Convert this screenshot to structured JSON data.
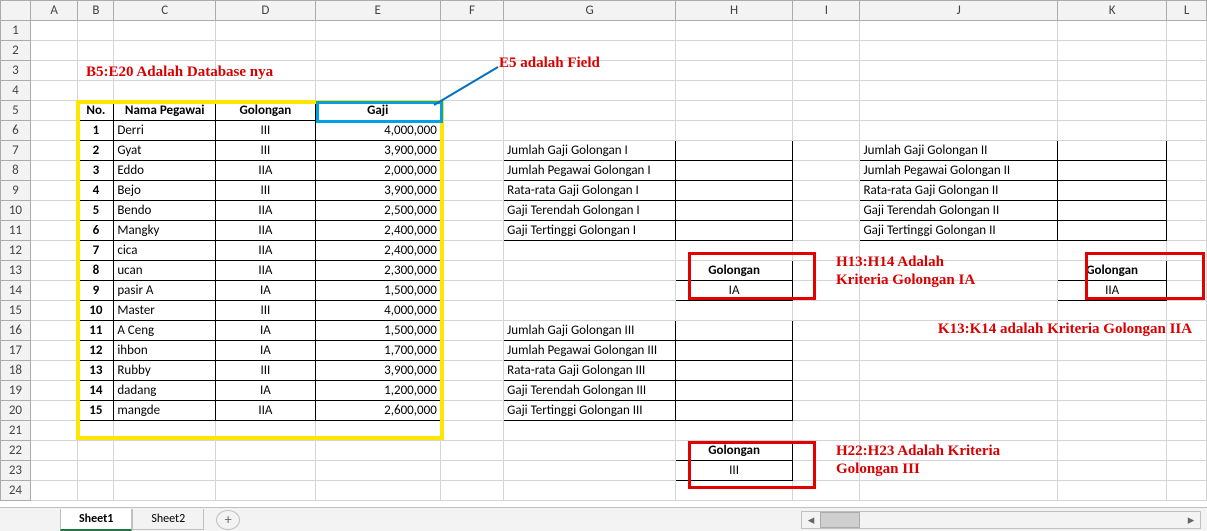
{
  "columns": [
    "A",
    "B",
    "C",
    "D",
    "E",
    "F",
    "G",
    "H",
    "I",
    "J",
    "K",
    "L"
  ],
  "row_numbers": [
    "1",
    "2",
    "3",
    "4",
    "5",
    "6",
    "7",
    "8",
    "9",
    "10",
    "11",
    "12",
    "13",
    "14",
    "15",
    "16",
    "17",
    "18",
    "19",
    "20",
    "21",
    "22",
    "23",
    "24"
  ],
  "table_header": {
    "no": "No.",
    "nama": "Nama Pegawai",
    "gol": "Golongan",
    "gaji": "Gaji"
  },
  "employees": [
    {
      "no": "1",
      "nama": "Derri",
      "gol": "III",
      "gaji": "4,000,000"
    },
    {
      "no": "2",
      "nama": "Gyat",
      "gol": "III",
      "gaji": "3,900,000"
    },
    {
      "no": "3",
      "nama": "Eddo",
      "gol": "IIA",
      "gaji": "2,000,000"
    },
    {
      "no": "4",
      "nama": "Bejo",
      "gol": "III",
      "gaji": "3,900,000"
    },
    {
      "no": "5",
      "nama": "Bendo",
      "gol": "IIA",
      "gaji": "2,500,000"
    },
    {
      "no": "6",
      "nama": "Mangky",
      "gol": "IIA",
      "gaji": "2,400,000"
    },
    {
      "no": "7",
      "nama": "cica",
      "gol": "IIA",
      "gaji": "2,400,000"
    },
    {
      "no": "8",
      "nama": "ucan",
      "gol": "IIA",
      "gaji": "2,300,000"
    },
    {
      "no": "9",
      "nama": "pasir A",
      "gol": "IA",
      "gaji": "1,500,000"
    },
    {
      "no": "10",
      "nama": "Master",
      "gol": "III",
      "gaji": "4,000,000"
    },
    {
      "no": "11",
      "nama": "A Ceng",
      "gol": "IA",
      "gaji": "1,500,000"
    },
    {
      "no": "12",
      "nama": "ihbon",
      "gol": "IA",
      "gaji": "1,700,000"
    },
    {
      "no": "13",
      "nama": "Rubby",
      "gol": "III",
      "gaji": "3,900,000"
    },
    {
      "no": "14",
      "nama": "dadang",
      "gol": "IA",
      "gaji": "1,200,000"
    },
    {
      "no": "15",
      "nama": "mangde",
      "gol": "IIA",
      "gaji": "2,600,000"
    }
  ],
  "stats_groupI": [
    "Jumlah Gaji Golongan I",
    "Jumlah Pegawai Golongan I",
    "Rata-rata Gaji Golongan I",
    "Gaji Terendah Golongan I",
    "Gaji Tertinggi Golongan I"
  ],
  "stats_groupII": [
    "Jumlah Gaji Golongan II",
    "Jumlah Pegawai Golongan II",
    "Rata-rata Gaji Golongan II",
    "Gaji Terendah Golongan II",
    "Gaji Tertinggi Golongan II"
  ],
  "stats_groupIII": [
    "Jumlah Gaji Golongan III",
    "Jumlah Pegawai Golongan III",
    "Rata-rata Gaji Golongan III",
    "Gaji Terendah Golongan III",
    "Gaji Tertinggi Golongan III"
  ],
  "criteria_H": {
    "hdr": "Golongan",
    "val": "IA"
  },
  "criteria_K": {
    "hdr": "Golongan",
    "val": "IIA"
  },
  "criteria_H2": {
    "hdr": "Golongan",
    "val": "III"
  },
  "annotations": {
    "db": "B5:E20 Adalah Database nya",
    "field": "E5 adalah Field",
    "h13": "H13:H14 Adalah\nKriteria\nGolongan IA",
    "k13": "K13:K14 adalah Kriteria Golongan\nIIA",
    "h22": "H22:H23 Adalah\nKriteria Golongan\nIII"
  },
  "tabs": {
    "sheet1": "Sheet1",
    "sheet2": "Sheet2"
  }
}
